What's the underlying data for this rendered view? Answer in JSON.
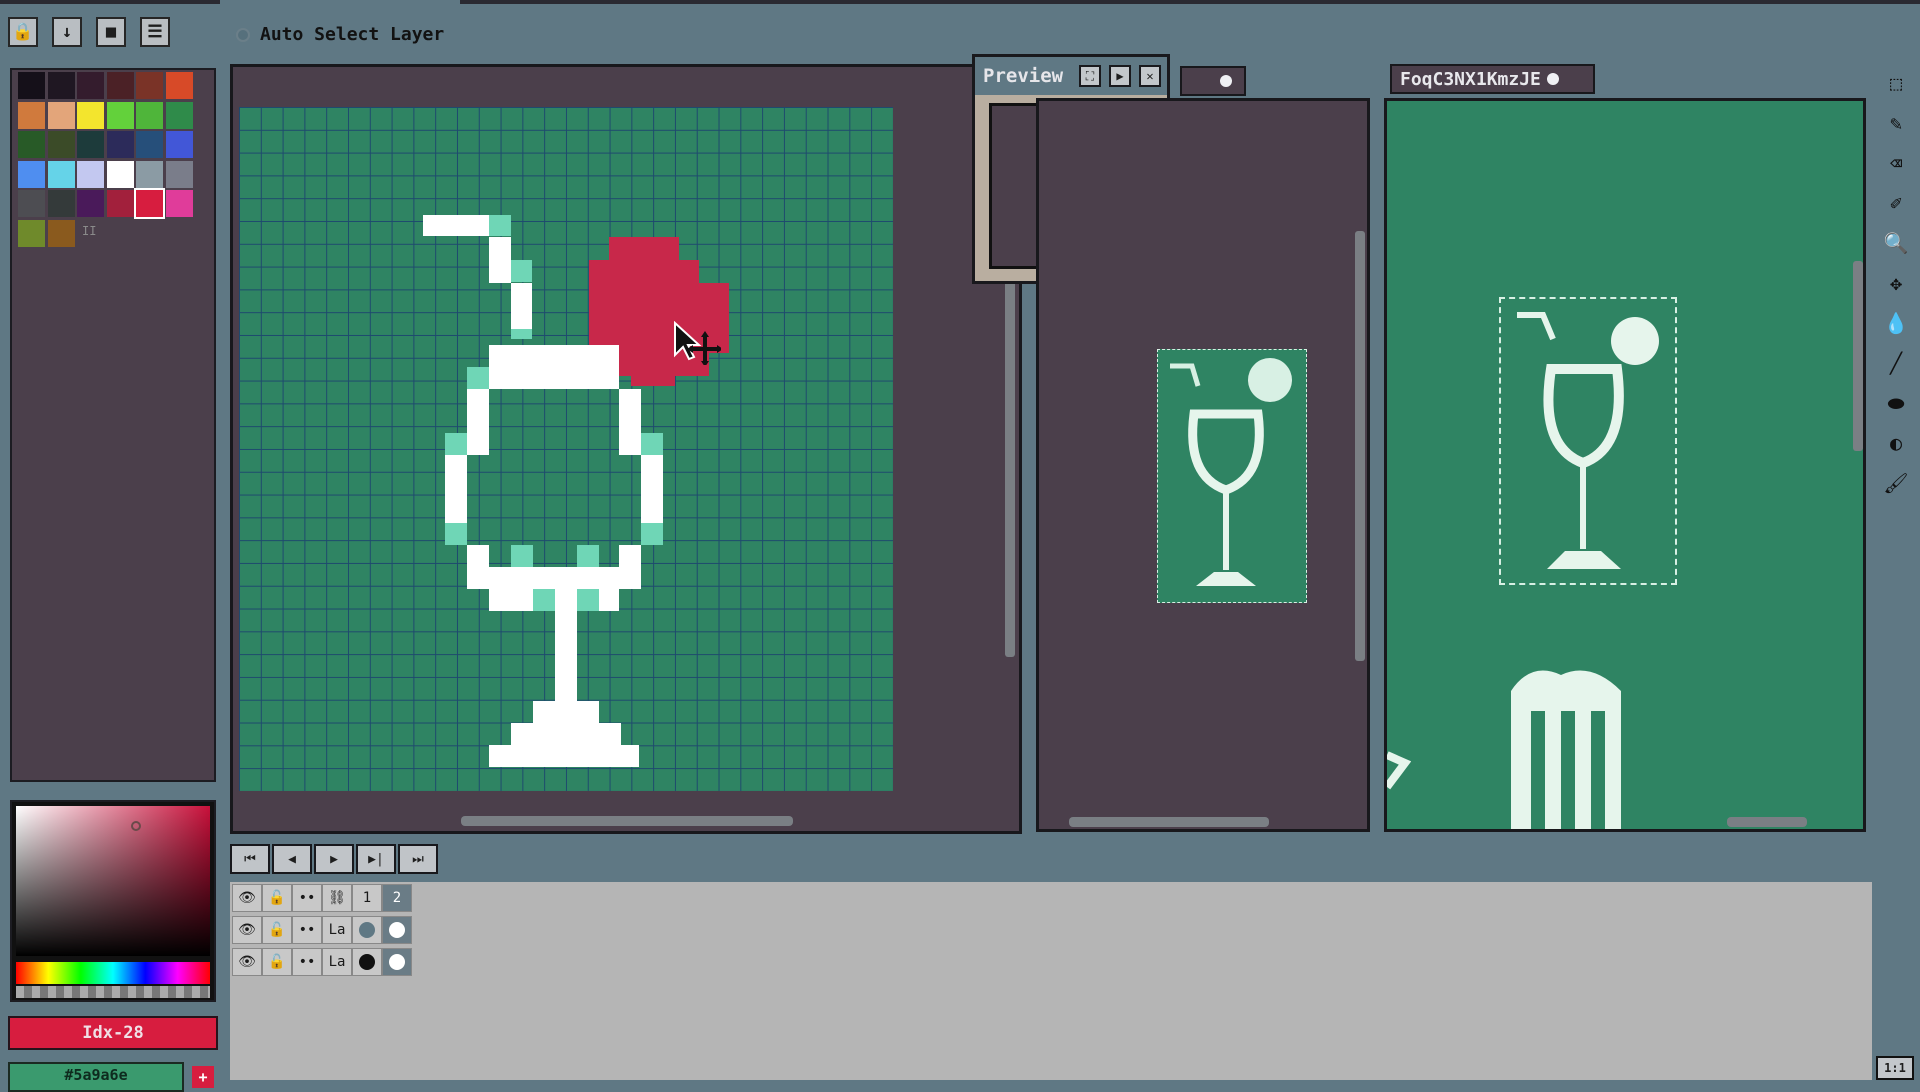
{
  "toolbar": {
    "lock_icon": "lock-icon",
    "download_icon": "down-arrow-icon",
    "stop_icon": "square-icon",
    "menu_icon": "hamburger-menu-icon",
    "auto_select_label": "Auto Select Layer"
  },
  "palette": {
    "colors": [
      "#151019",
      "#1f1722",
      "#341c2d",
      "#4b2126",
      "#7a3327",
      "#d74a28",
      "#d07a3d",
      "#e3a57a",
      "#f3e52d",
      "#63d13b",
      "#4fb53a",
      "#2f8b4a",
      "#285a27",
      "#3b4b28",
      "#1d3b3b",
      "#2c2b5a",
      "#264f7a",
      "#4257d7",
      "#4f8ef0",
      "#65d3e8",
      "#c3c8f0",
      "#ffffff",
      "#8b9ba4",
      "#7a7d8a",
      "#4d4d52",
      "#343a3a",
      "#4a1a5a",
      "#a2203c",
      "#d71d3f",
      "#e03c9a",
      "#6f8a2b",
      "#8a5a1e"
    ],
    "extra_marker": "II"
  },
  "color_picker": {
    "idx_label": "Idx-28",
    "hex_label": "#5a9a6e",
    "add_label": "+"
  },
  "preview": {
    "title": "Preview",
    "expand_icon": "expand-icon",
    "play_icon": "play-icon",
    "close_icon": "close-icon",
    "thumb_glyph": "🍸"
  },
  "doc3": {
    "tab_label": "FoqC3NX1KmzJE"
  },
  "timeline": {
    "buttons": [
      "⏮",
      "◀",
      "▶",
      "▶|",
      "⏭"
    ]
  },
  "layers": {
    "header": {
      "frame1": "1",
      "frame2": "2"
    },
    "rows": [
      {
        "name": "La"
      },
      {
        "name": "La"
      }
    ],
    "one_to_one": "1:1"
  }
}
